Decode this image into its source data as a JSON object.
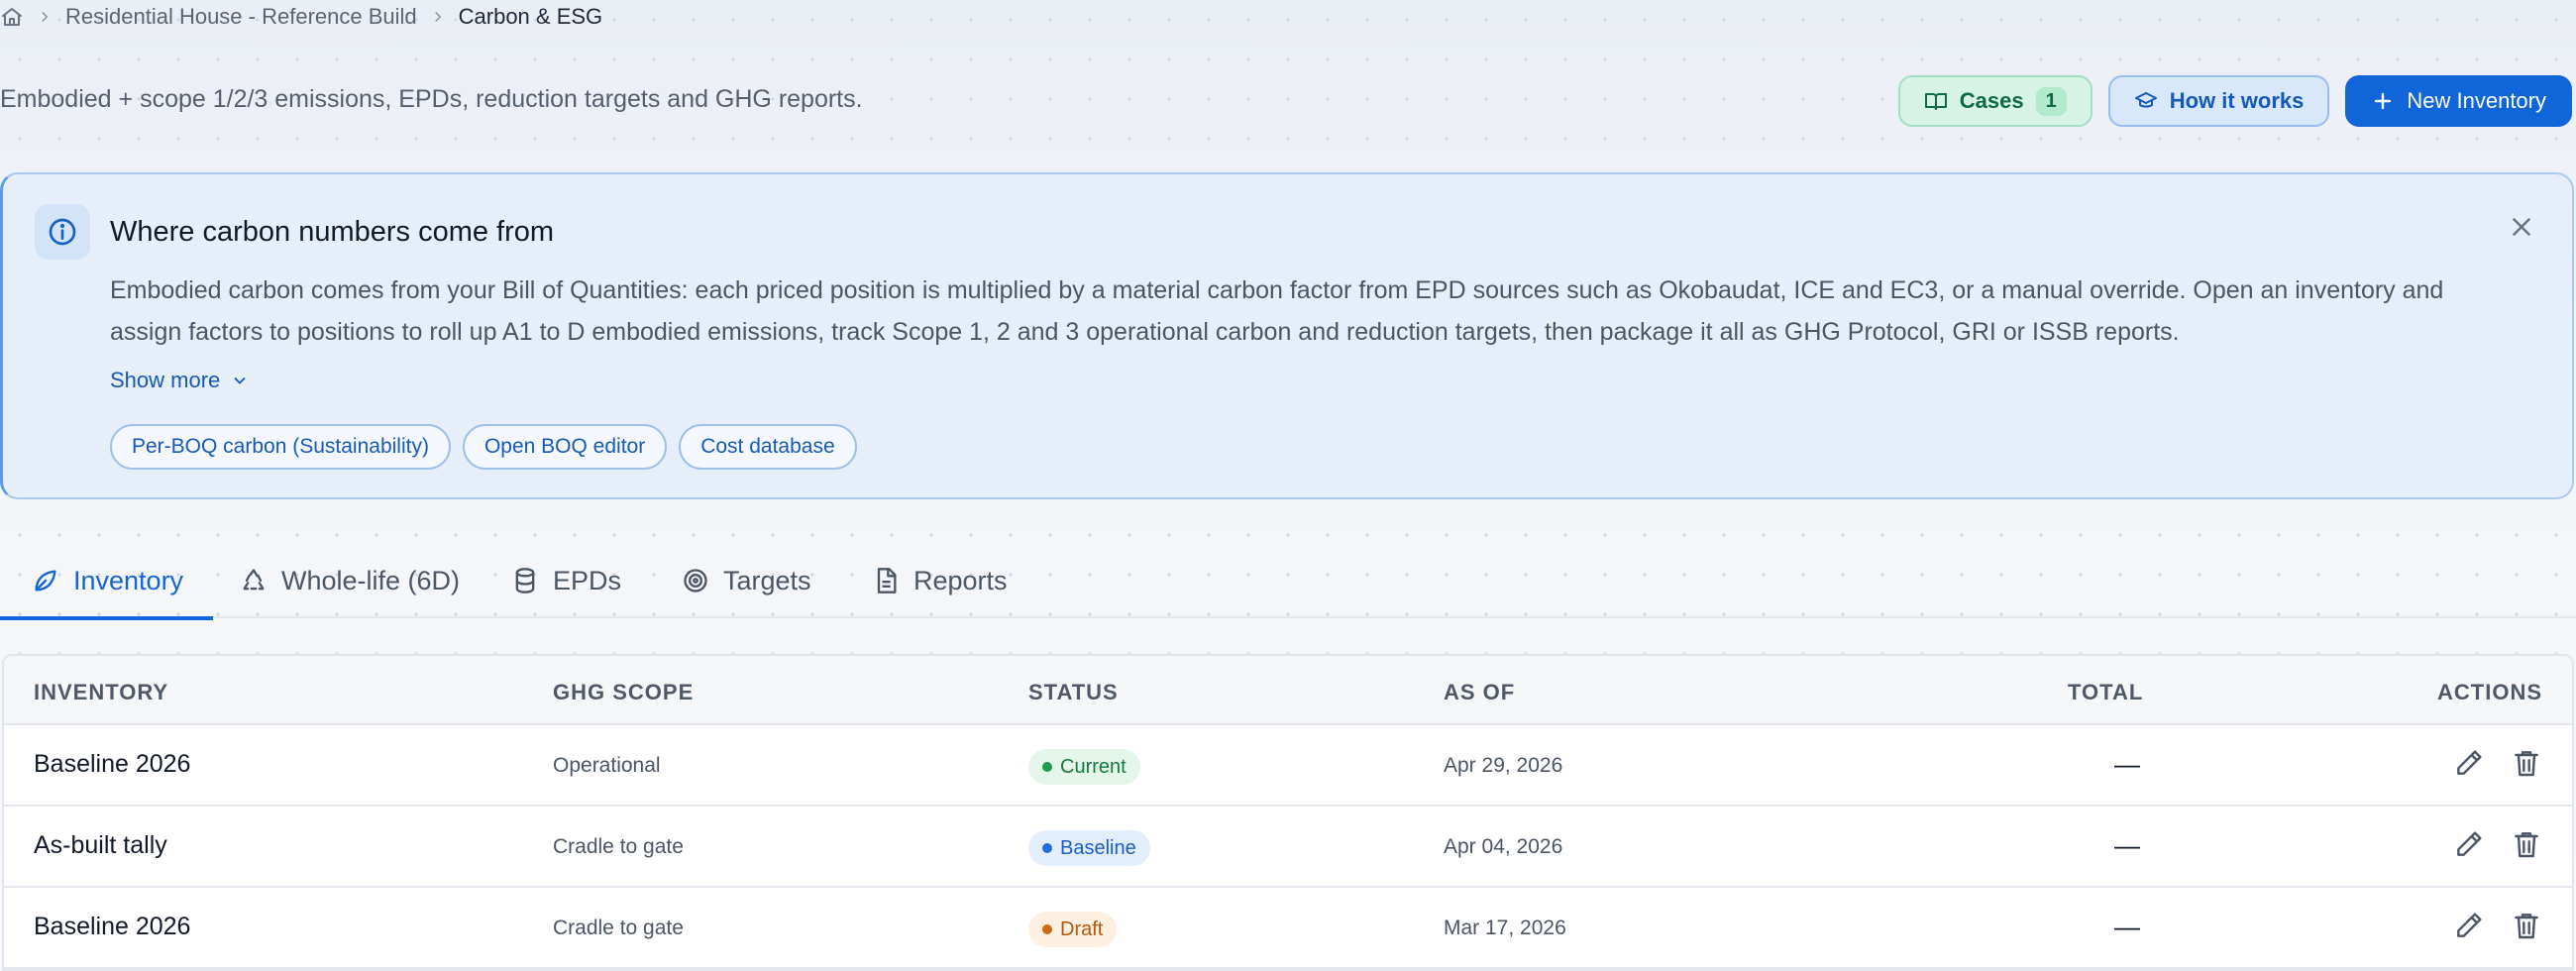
{
  "breadcrumb": {
    "home_icon": "home-icon",
    "project": "Residential House - Reference Build",
    "current": "Carbon & ESG"
  },
  "subtitle": "Embodied + scope 1/2/3 emissions, EPDs, reduction targets and GHG reports.",
  "header_actions": {
    "cases_label": "Cases",
    "cases_count": "1",
    "how_label": "How it works",
    "new_label": "New Inventory"
  },
  "info": {
    "title": "Where carbon numbers come from",
    "body_line1": "Embodied carbon comes from your Bill of Quantities: each priced position is multiplied by a material carbon factor from EPD sources such as Okobaudat, ICE and EC3, or a manual override. Open an inventory and",
    "body_line2": "assign factors to positions to roll up A1 to D embodied emissions, track Scope 1, 2 and 3 operational carbon and reduction targets, then package it all as GHG Protocol, GRI or ISSB reports.",
    "show_more": "Show more",
    "chips": [
      "Per-BOQ carbon (Sustainability)",
      "Open BOQ editor",
      "Cost database"
    ]
  },
  "tabs": [
    {
      "label": "Inventory",
      "icon": "leaf-icon",
      "active": true
    },
    {
      "label": "Whole-life (6D)",
      "icon": "recycle-icon",
      "active": false
    },
    {
      "label": "EPDs",
      "icon": "database-icon",
      "active": false
    },
    {
      "label": "Targets",
      "icon": "target-icon",
      "active": false
    },
    {
      "label": "Reports",
      "icon": "file-text-icon",
      "active": false
    }
  ],
  "table": {
    "headers": {
      "inventory": "INVENTORY",
      "scope": "GHG SCOPE",
      "status": "STATUS",
      "as_of": "AS OF",
      "total": "TOTAL",
      "actions": "ACTIONS"
    },
    "rows": [
      {
        "inventory": "Baseline 2026",
        "scope": "Operational",
        "status": "Current",
        "as_of": "Apr 29, 2026",
        "total": "—"
      },
      {
        "inventory": "As-built tally",
        "scope": "Cradle to gate",
        "status": "Baseline",
        "as_of": "Apr 04, 2026",
        "total": "—"
      },
      {
        "inventory": "Baseline 2026",
        "scope": "Cradle to gate",
        "status": "Draft",
        "as_of": "Mar 17, 2026",
        "total": "—"
      }
    ]
  },
  "colors": {
    "primary": "#1065d8",
    "status_current": "#177a3c",
    "status_baseline": "#1a5fc4",
    "status_draft": "#b3580e"
  }
}
